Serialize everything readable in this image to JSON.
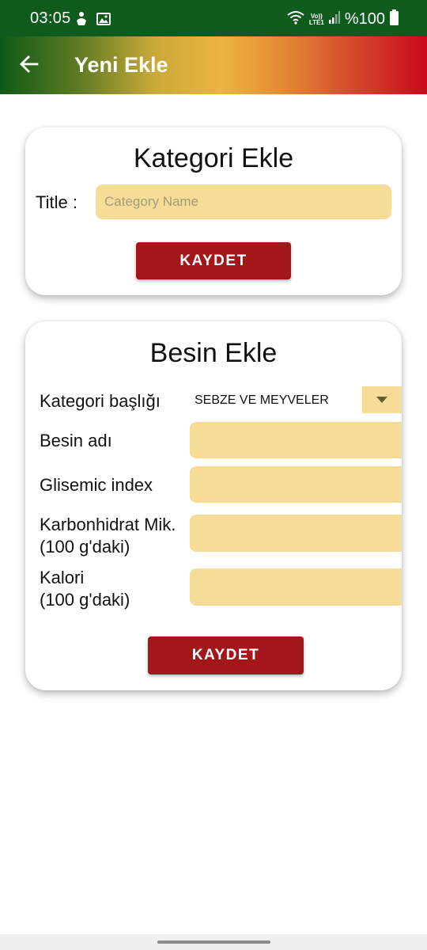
{
  "status_bar": {
    "time": "03:05",
    "network_label": "Vo))\nLTE1",
    "battery": "%100"
  },
  "app_bar": {
    "title": "Yeni Ekle"
  },
  "category_card": {
    "title": "Kategori Ekle",
    "field_label": "Title :",
    "field_value": "",
    "field_placeholder": "Category Name",
    "save_label": "KAYDET"
  },
  "food_card": {
    "title": "Besin Ekle",
    "category_label": "Kategori başlığı",
    "category_selected": "SEBZE VE MEYVELER",
    "name_label": "Besin adı",
    "name_value": "",
    "gi_label": "Glisemic index",
    "gi_value": "",
    "carb_label_line1": "Karbonhidrat Mik.",
    "carb_label_line2": "(100 g'daki)",
    "carb_value": "",
    "cal_label_line1": "Kalori",
    "cal_label_line2": "(100 g'daki)",
    "cal_value": "",
    "save_label": "KAYDET"
  },
  "icons": {
    "back": "arrow-left-icon",
    "status_left": [
      "hand-icon",
      "image-icon"
    ],
    "status_right": [
      "wifi-icon",
      "signal-icon",
      "battery-icon"
    ],
    "dropdown": "dropdown-arrow-icon"
  },
  "colors": {
    "status_bar": "#0f5b1e",
    "input_fill": "#f5dc97",
    "button": "#a31619",
    "gradient_start": "#0d5a17",
    "gradient_mid": "#ecb53f",
    "gradient_end": "#c9081a"
  }
}
